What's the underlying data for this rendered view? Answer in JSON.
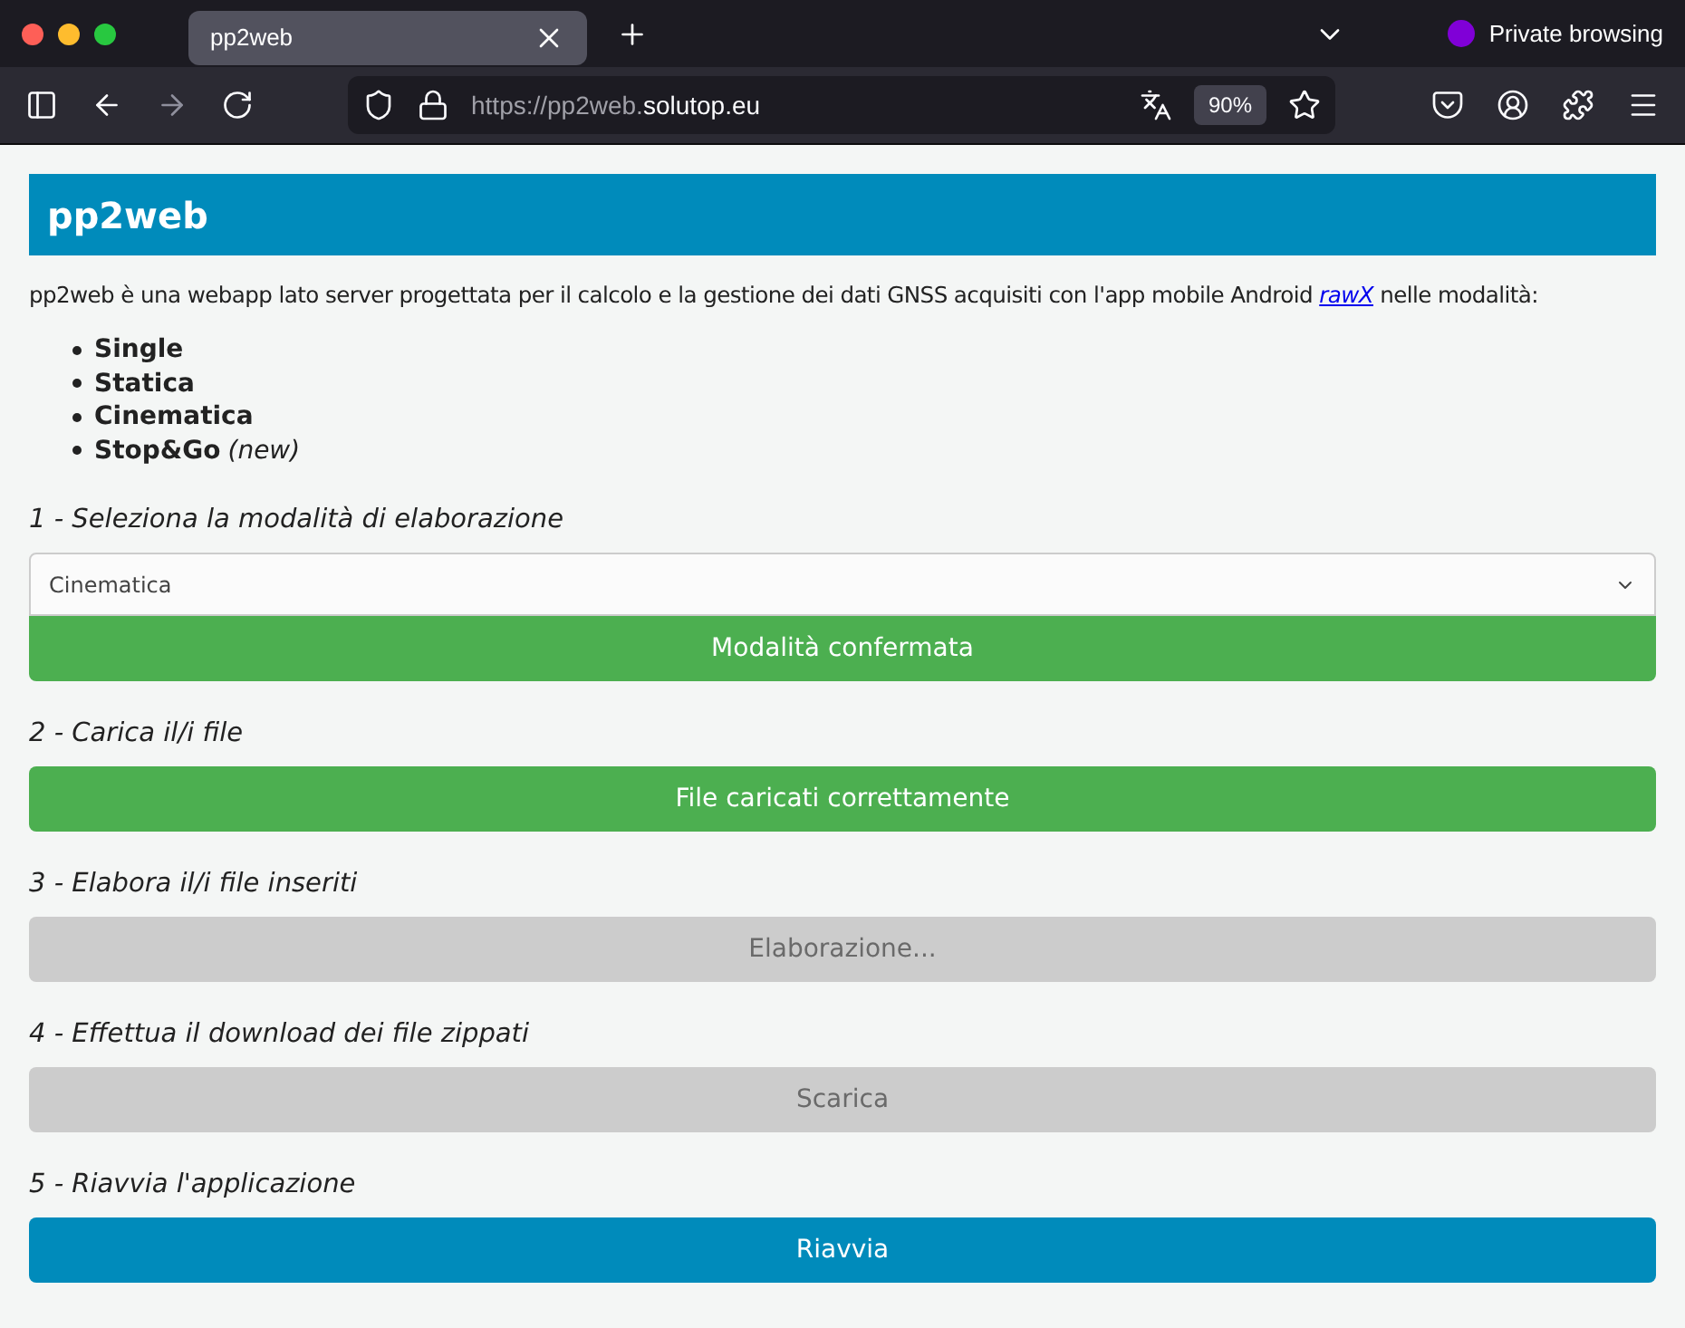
{
  "browser": {
    "tab": {
      "title": "pp2web",
      "selected": true
    },
    "private_label": "Private browsing",
    "url_prefix": "https://pp2web.",
    "url_domain": "solutop.eu",
    "zoom": "90%"
  },
  "page": {
    "title": "pp2web",
    "intro": {
      "before": "pp2web è una webapp lato server progettata per il calcolo e la gestione dei dati GNSS acquisiti con l'app mobile Android",
      "link": "rawX",
      "after": "nelle modalità:"
    },
    "modes": [
      {
        "label": "Single"
      },
      {
        "label": "Statica"
      },
      {
        "label": "Cinematica"
      },
      {
        "label": "Stop&Go",
        "note": "(new)"
      }
    ],
    "steps": [
      {
        "heading": "1 - Seleziona la modalità di elaborazione",
        "select": {
          "value": "Cinematica"
        },
        "button": {
          "label": "Modalità confermata",
          "kind": "done"
        }
      },
      {
        "heading": "2 - Carica il/i file",
        "button": {
          "label": "File caricati correttamente",
          "kind": "done"
        }
      },
      {
        "heading": "3 - Elabora il/i file inseriti",
        "button": {
          "label": "Elaborazione...",
          "kind": "disabled"
        }
      },
      {
        "heading": "4 - Effettua il download dei file zippati",
        "button": {
          "label": "Scarica",
          "kind": "disabled"
        }
      },
      {
        "heading": "5 - Riavvia l'applicazione",
        "button": {
          "label": "Riavvia",
          "kind": "action"
        }
      }
    ]
  }
}
